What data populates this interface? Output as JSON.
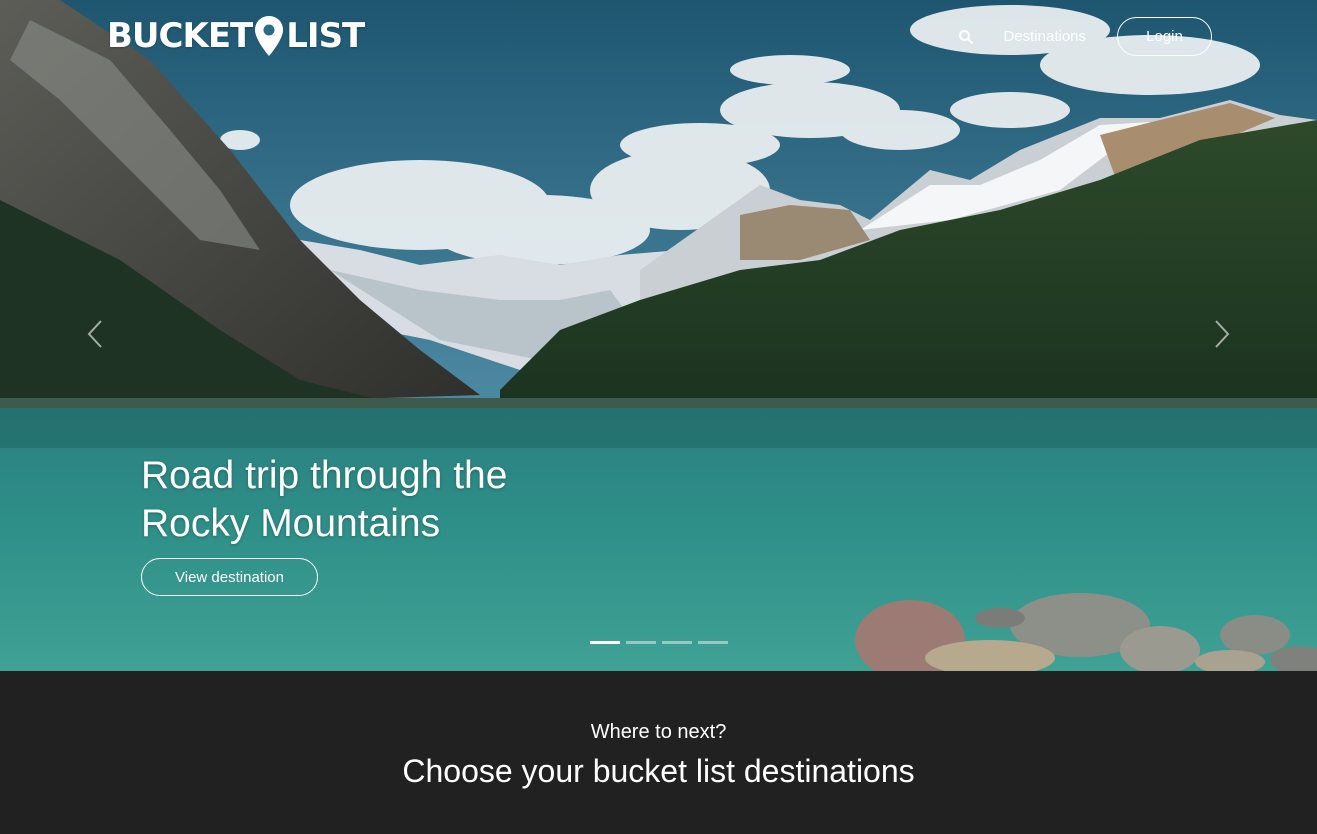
{
  "header": {
    "logo_left": "BUCKET",
    "logo_right": "LIST",
    "nav": {
      "search_icon": "search-icon",
      "destinations_label": "Destinations",
      "login_label": "Login"
    }
  },
  "carousel": {
    "prev_icon": "chevron-left-icon",
    "next_icon": "chevron-right-icon",
    "slide": {
      "title": "Road trip through the Rocky Mountains",
      "button_label": "View destination"
    },
    "indicators": [
      {
        "active": true
      },
      {
        "active": false
      },
      {
        "active": false
      },
      {
        "active": false
      }
    ]
  },
  "section": {
    "kicker": "Where to next?",
    "heading": "Choose your bucket list destinations"
  },
  "colors": {
    "accent": "#ffffff",
    "section_bg": "#212121",
    "sky": "#2b6b86",
    "lake": "#2f8a85"
  }
}
